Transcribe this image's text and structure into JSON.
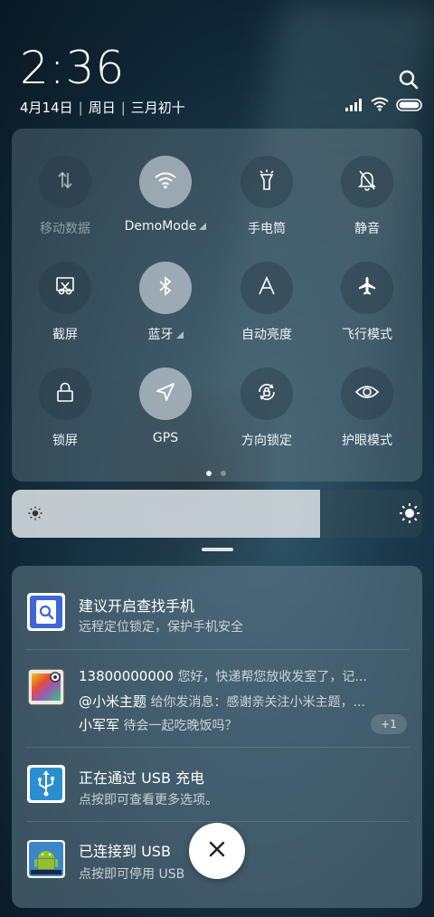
{
  "header": {
    "time": "2:36",
    "date": "4月14日",
    "weekday": "周日",
    "lunar": "三月初十"
  },
  "quick_settings": {
    "tiles": [
      {
        "label": "移动数据",
        "icon": "mobile-data-icon",
        "active": false,
        "dim": true
      },
      {
        "label": "DemoMode",
        "icon": "wifi-icon",
        "active": true,
        "dropdown": true
      },
      {
        "label": "手电筒",
        "icon": "flashlight-icon",
        "active": false
      },
      {
        "label": "静音",
        "icon": "mute-bell-icon",
        "active": false
      },
      {
        "label": "截屏",
        "icon": "screenshot-icon",
        "active": false
      },
      {
        "label": "蓝牙",
        "icon": "bluetooth-icon",
        "active": true,
        "dropdown": true
      },
      {
        "label": "自动亮度",
        "icon": "auto-brightness-icon",
        "active": false
      },
      {
        "label": "飞行模式",
        "icon": "airplane-icon",
        "active": false
      },
      {
        "label": "锁屏",
        "icon": "lock-icon",
        "active": false
      },
      {
        "label": "GPS",
        "icon": "gps-icon",
        "active": true
      },
      {
        "label": "方向锁定",
        "icon": "rotation-lock-icon",
        "active": false
      },
      {
        "label": "护眼模式",
        "icon": "eye-icon",
        "active": false
      }
    ],
    "page_count": 2,
    "current_page": 1
  },
  "brightness": {
    "level": 0.75
  },
  "notifications": [
    {
      "title": "建议开启查找手机",
      "subtitle": "远程定位锁定，保护手机安全",
      "icon": "find-phone-icon"
    },
    {
      "icon": "gallery-icon",
      "messages": [
        {
          "sender": "13800000000",
          "text": "您好，快递帮您放收发室了，记..."
        },
        {
          "sender": "@小米主题",
          "text": "给你发消息：感谢亲关注小米主题，..."
        },
        {
          "sender": "小军军",
          "text": "待会一起吃晚饭吗？"
        }
      ],
      "more_count": "+1"
    },
    {
      "title": "正在通过 USB 充电",
      "subtitle": "点按即可查看更多选项。",
      "icon": "usb-icon"
    },
    {
      "title": "已连接到 USB",
      "subtitle": "点按即可停用 USB",
      "icon": "android-icon"
    }
  ],
  "colors": {
    "usb_icon_bg": "#2a8fd0",
    "find_phone_bg": "#3d66d6",
    "android_green": "#97c024"
  }
}
